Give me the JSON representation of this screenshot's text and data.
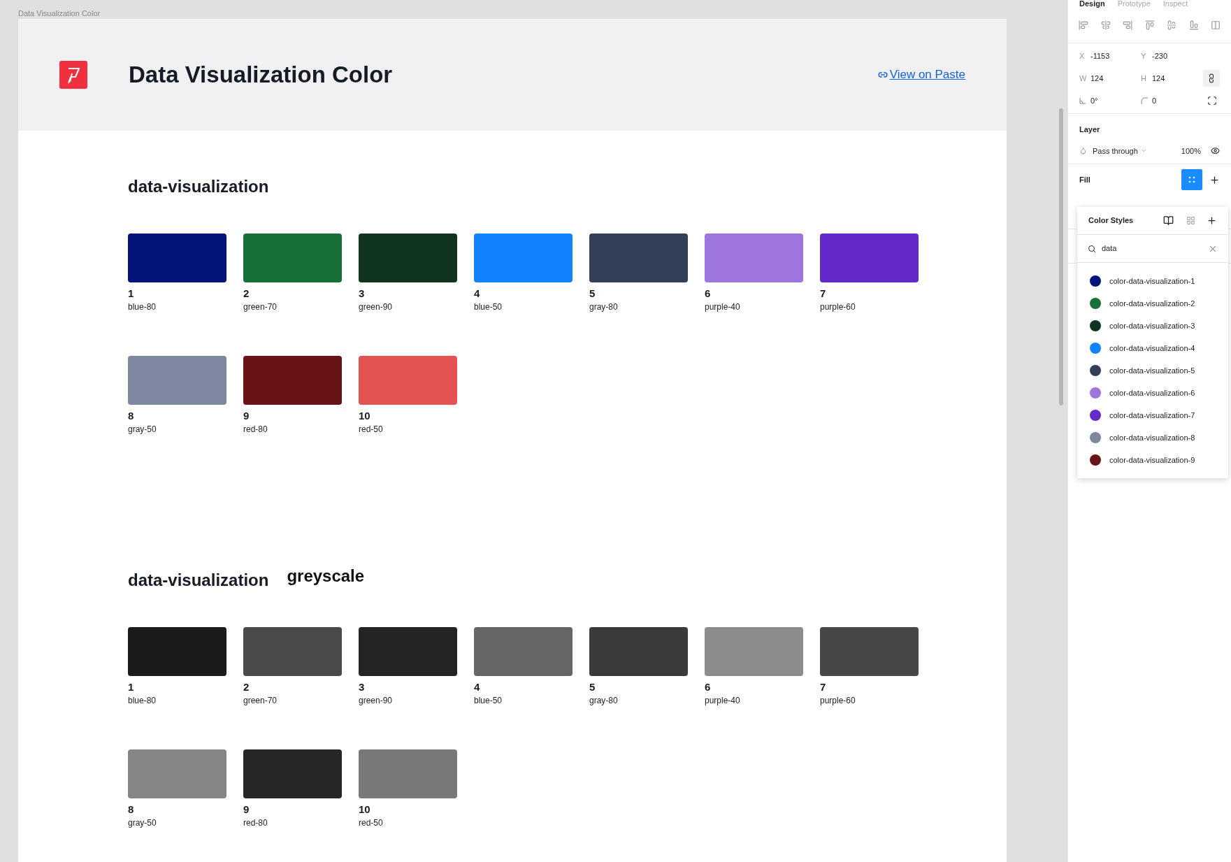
{
  "canvas": {
    "frame_label": "Data Visualization Color"
  },
  "header": {
    "title": "Data Visualization Color",
    "link": "View on Paste"
  },
  "sections": [
    {
      "title": "data-visualization",
      "swatches": [
        {
          "number": "1",
          "name": "blue-80",
          "color": "#02157a"
        },
        {
          "number": "2",
          "name": "green-70",
          "color": "#167037"
        },
        {
          "number": "3",
          "name": "green-90",
          "color": "#11341f"
        },
        {
          "number": "4",
          "name": "blue-50",
          "color": "#1383fd"
        },
        {
          "number": "5",
          "name": "gray-80",
          "color": "#333e58"
        },
        {
          "number": "6",
          "name": "purple-40",
          "color": "#9d75dc"
        },
        {
          "number": "7",
          "name": "purple-60",
          "color": "#632ac9"
        },
        {
          "number": "8",
          "name": "gray-50",
          "color": "#7d879e"
        },
        {
          "number": "9",
          "name": "red-80",
          "color": "#681315"
        },
        {
          "number": "10",
          "name": "red-50",
          "color": "#e55252"
        }
      ]
    },
    {
      "title": "data-visualization",
      "subtitle": "greyscale",
      "swatches": [
        {
          "number": "1",
          "name": "blue-80",
          "color": "#1b1b1b"
        },
        {
          "number": "2",
          "name": "green-70",
          "color": "#4a4a4a"
        },
        {
          "number": "3",
          "name": "green-90",
          "color": "#242424"
        },
        {
          "number": "4",
          "name": "blue-50",
          "color": "#666666"
        },
        {
          "number": "5",
          "name": "gray-80",
          "color": "#3b3b3b"
        },
        {
          "number": "6",
          "name": "purple-40",
          "color": "#8c8c8c"
        },
        {
          "number": "7",
          "name": "purple-60",
          "color": "#474747"
        },
        {
          "number": "8",
          "name": "gray-50",
          "color": "#858585"
        },
        {
          "number": "9",
          "name": "red-80",
          "color": "#262626"
        },
        {
          "number": "10",
          "name": "red-50",
          "color": "#787878"
        }
      ]
    }
  ],
  "panel": {
    "tabs": [
      {
        "label": "Design",
        "selected": true
      },
      {
        "label": "Prototype",
        "selected": false
      },
      {
        "label": "Inspect",
        "selected": false
      }
    ],
    "fields": [
      [
        {
          "label": "X",
          "value": "-1153"
        },
        {
          "label": "Y",
          "value": "-230"
        }
      ],
      [
        {
          "label": "W",
          "value": "124"
        },
        {
          "label": "H",
          "value": "124"
        }
      ],
      [
        {
          "kind": "rotation",
          "value": "0°"
        },
        {
          "kind": "radius",
          "value": "0"
        }
      ]
    ],
    "layer": {
      "title": "Layer",
      "blend": "Pass through",
      "opacity": "100%"
    },
    "fill": {
      "title": "Fill"
    },
    "color_styles": {
      "title": "Color Styles",
      "search": "data",
      "items": [
        {
          "name": "color-data-visualization-1",
          "color": "#02157a"
        },
        {
          "name": "color-data-visualization-2",
          "color": "#167037"
        },
        {
          "name": "color-data-visualization-3",
          "color": "#11341f"
        },
        {
          "name": "color-data-visualization-4",
          "color": "#1383fd"
        },
        {
          "name": "color-data-visualization-5",
          "color": "#333e58"
        },
        {
          "name": "color-data-visualization-6",
          "color": "#9d75dc"
        },
        {
          "name": "color-data-visualization-7",
          "color": "#632ac9"
        },
        {
          "name": "color-data-visualization-8",
          "color": "#7d879e"
        },
        {
          "name": "color-data-visualization-9",
          "color": "#681315"
        }
      ]
    }
  }
}
